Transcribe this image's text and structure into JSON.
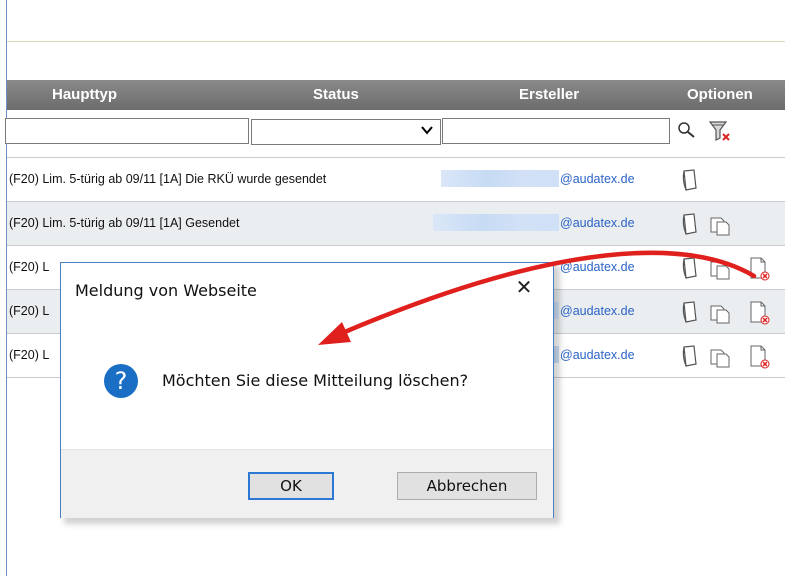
{
  "table": {
    "headers": {
      "haupttyp": "Haupttyp",
      "status": "Status",
      "ersteller": "Ersteller",
      "optionen": "Optionen"
    },
    "rows": [
      {
        "text": "(F20) Lim. 5-türig ab 09/11 [1A] Die RKÜ wurde gesendet",
        "mail": "@audatex.de"
      },
      {
        "text": "(F20) Lim. 5-türig ab 09/11 [1A] Gesendet",
        "mail": "@audatex.de"
      },
      {
        "text": "(F20) L",
        "mail": "@audatex.de"
      },
      {
        "text": "(F20) L",
        "mail": "@audatex.de"
      },
      {
        "text": "(F20) L",
        "mail": "@audatex.de"
      }
    ]
  },
  "dialog": {
    "title": "Meldung von Webseite",
    "close": "✕",
    "message": "Möchten Sie diese Mitteilung löschen?",
    "ok_label": "OK",
    "cancel_label": "Abbrechen"
  },
  "colors": {
    "header_bg": "#7a7a7a",
    "link": "#2b63c6",
    "arrow": "#e0201c",
    "dialog_border": "#4d7fc6",
    "question_icon": "#1a6fc4"
  },
  "icons": [
    "search-icon",
    "filter-reset-icon",
    "document-icon",
    "documents-icon",
    "delete-document-icon",
    "question-icon"
  ]
}
